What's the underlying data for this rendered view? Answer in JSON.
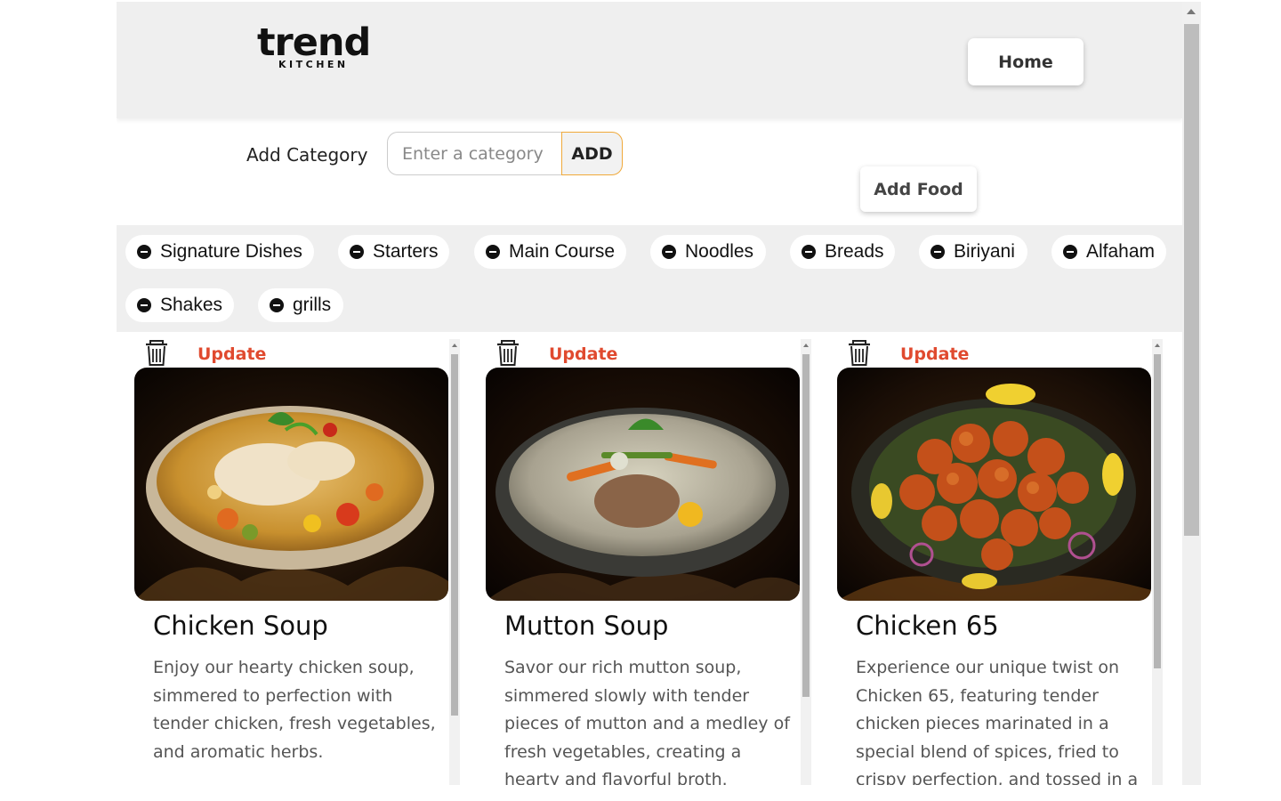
{
  "brand": {
    "logo_main": "trend",
    "logo_sub": "KITCHEN"
  },
  "header": {
    "home_label": "Home"
  },
  "add_category": {
    "label": "Add Category",
    "placeholder": "Enter a category",
    "add_label": "ADD"
  },
  "add_food_label": "Add Food",
  "categories": [
    "Signature Dishes",
    "Starters",
    "Main Course",
    "Noodles",
    "Breads",
    "Biriyani",
    "Alfaham",
    "Shakes",
    "grills"
  ],
  "cards": [
    {
      "update_label": "Update",
      "title": "Chicken Soup",
      "description": "Enjoy our hearty chicken soup, simmered to perfection with tender chicken, fresh vegetables, and aromatic herbs.",
      "photo_alt": "chicken-soup-photo"
    },
    {
      "update_label": "Update",
      "title": "Mutton Soup",
      "description": "Savor our rich mutton soup, simmered slowly with tender pieces of mutton and a medley of fresh vegetables, creating a hearty and flavorful broth.",
      "photo_alt": "mutton-soup-photo"
    },
    {
      "update_label": "Update",
      "title": "Chicken 65",
      "description": "Experience our unique twist on Chicken 65, featuring tender chicken pieces marinated in a special blend of spices, fried to crispy perfection, and tossed in a",
      "photo_alt": "chicken-65-photo"
    }
  ],
  "colors": {
    "accent_update": "#e04a2f",
    "add_border": "#f0a93a",
    "header_bg": "#efefef"
  }
}
